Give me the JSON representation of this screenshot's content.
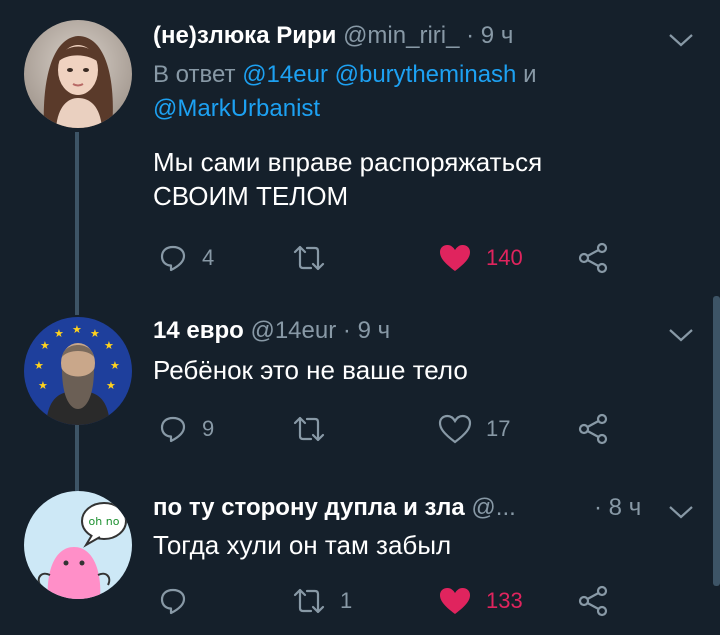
{
  "tweets": [
    {
      "name": "(не)злюка Рири",
      "handle": "@min_riri_",
      "sep": "·",
      "time": "9 ч",
      "reply_prefix": "В ответ",
      "reply_handles": [
        "@14eur",
        "@burytheminash"
      ],
      "reply_and": "и",
      "reply_last": "@MarkUrbanist",
      "text_lines": [
        "Мы сами вправе распоряжаться",
        "СВОИМ ТЕЛОМ"
      ],
      "replies": "4",
      "retweets": "",
      "likes": "140",
      "liked": true
    },
    {
      "name": "14 евро",
      "handle": "@14eur",
      "sep": "·",
      "time": "9 ч",
      "text_lines": [
        "Ребёнок это не ваше тело"
      ],
      "replies": "9",
      "retweets": "",
      "likes": "17",
      "liked": false
    },
    {
      "name": "по ту сторону дупла и зла",
      "handle": "@...",
      "sep": "·",
      "time": "8 ч",
      "avatar_text": "oh no",
      "text_lines": [
        "Тогда хули он там забыл"
      ],
      "replies": "",
      "retweets": "1",
      "likes": "133",
      "liked": true
    }
  ],
  "colors": {
    "background": "#15202b",
    "secondary_text": "#8899a6",
    "link": "#1da1f2",
    "like": "#e0245e",
    "thread_line": "#3d5466"
  },
  "icons": [
    "reply-icon",
    "retweet-icon",
    "like-icon",
    "share-icon",
    "chevron-down-icon"
  ]
}
